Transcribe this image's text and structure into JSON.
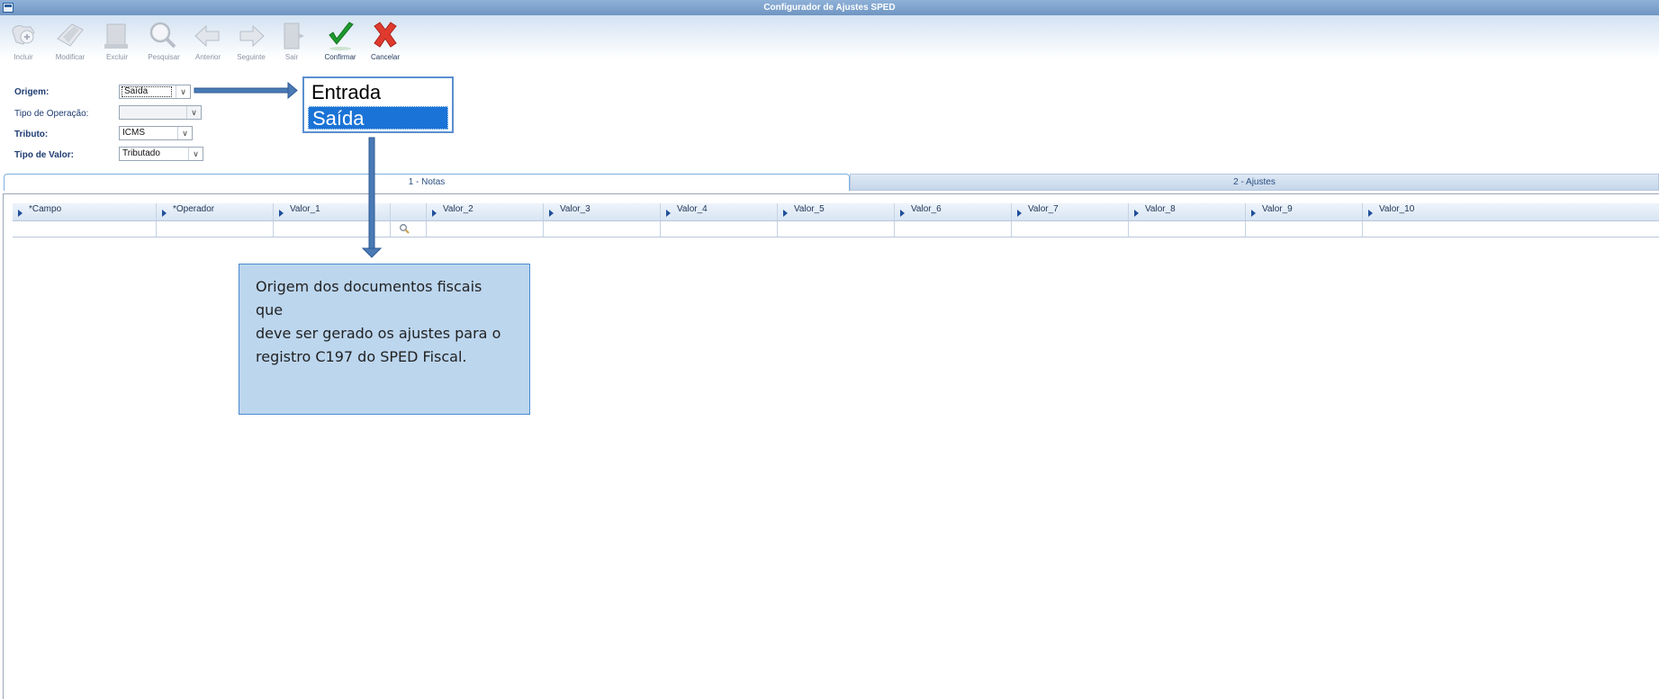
{
  "window": {
    "title": "Configurador de Ajustes SPED"
  },
  "toolbar": {
    "buttons": [
      {
        "label": "Incluir",
        "icon": "add-icon",
        "enabled": false
      },
      {
        "label": "Modificar",
        "icon": "edit-icon",
        "enabled": false
      },
      {
        "label": "Excluir",
        "icon": "delete-icon",
        "enabled": false
      },
      {
        "label": "Pesquisar",
        "icon": "magnifier-icon",
        "enabled": false
      },
      {
        "label": "Anterior",
        "icon": "arrow-left-icon",
        "enabled": false
      },
      {
        "label": "Seguinte",
        "icon": "arrow-right-icon",
        "enabled": false
      },
      {
        "label": "Sair",
        "icon": "exit-door-icon",
        "enabled": false
      },
      {
        "label": "Confirmar",
        "icon": "checkmark-icon",
        "enabled": true
      },
      {
        "label": "Cancelar",
        "icon": "x-cancel-icon",
        "enabled": true
      }
    ]
  },
  "form": {
    "origem": {
      "label": "Origem:",
      "value": "Saída"
    },
    "tipo_operacao": {
      "label": "Tipo de Operação:",
      "value": ""
    },
    "tributo": {
      "label": "Tributo:",
      "value": "ICMS"
    },
    "tipo_valor": {
      "label": "Tipo de Valor:",
      "value": "Tributado"
    }
  },
  "origem_dropdown": {
    "options": [
      "Entrada",
      "Saída"
    ],
    "selected": "Saída"
  },
  "tabs": [
    {
      "label": "1 - Notas",
      "active": true
    },
    {
      "label": "2 - Ajustes",
      "active": false
    }
  ],
  "grid": {
    "columns": [
      "*Campo",
      "*Operador",
      "Valor_1",
      "Valor_2",
      "Valor_3",
      "Valor_4",
      "Valor_5",
      "Valor_6",
      "Valor_7",
      "Valor_8",
      "Valor_9",
      "Valor_10"
    ]
  },
  "callout": {
    "lines": [
      "Origem dos documentos fiscais que",
      "deve ser gerado os ajustes para o",
      "registro C197 do SPED Fiscal."
    ]
  },
  "colors": {
    "accent": "#1a73d6",
    "callout_bg": "#bcd6ee",
    "arrow": "#4a7ab5"
  }
}
